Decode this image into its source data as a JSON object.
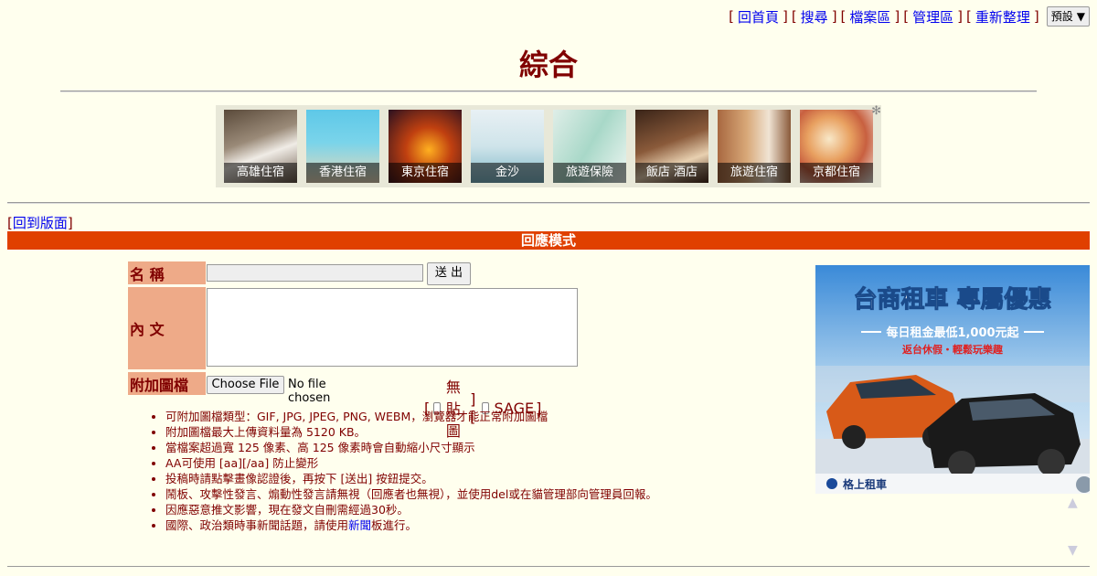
{
  "nav": {
    "links": [
      "回首頁",
      "搜尋",
      "檔案區",
      "管理區",
      "重新整理"
    ],
    "style_select": "預設"
  },
  "board_title": "綜合",
  "banner": {
    "tiles": [
      "高雄住宿",
      "香港住宿",
      "東京住宿",
      "金沙",
      "旅遊保險",
      "飯店 酒店",
      "旅遊住宿",
      "京都住宿"
    ]
  },
  "back_link": "回到版面",
  "mode_label": "回應模式",
  "form": {
    "name_label": "名 稱",
    "content_label": "內 文",
    "attach_label": "附加圖檔",
    "send_button": "送 出",
    "file_button": "Choose File",
    "file_status": "No file chosen",
    "no_image_label": "無貼圖",
    "sage_label": "SAGE"
  },
  "rules": [
    "可附加圖檔類型：GIF, JPG, JPEG, PNG, WEBM，瀏覽器才能正常附加圖檔",
    "附加圖檔最大上傳資料量為 5120 KB。",
    "當檔案超過寬 125 像素、高 125 像素時會自動縮小尺寸顯示",
    "AA可使用 [aa][/aa] 防止變形",
    "投稿時請點擊畫像認證後，再按下 [送出] 按鈕提交。",
    "鬧板、攻擊性發言、煽動性發言請無視（回應者也無視），並使用del或在貓管理部向管理員回報。",
    "因應惡意推文影響，現在發文自刪需經過30秒。"
  ],
  "last_rule": {
    "before": "國際、政治類時事新聞話題，請使用",
    "link": "新聞",
    "after": "板進行。"
  },
  "ad": {
    "headline": "台商租車 專屬優惠",
    "subline": "每日租金最低1,000元起",
    "tagline": "返台休假・輕鬆玩樂趣",
    "brand": "格上租車"
  },
  "colors": {
    "background": "#ffffee",
    "text": "#800000",
    "mode_bar": "#e04000",
    "label_bg": "#eeaa88",
    "link": "#0000ee"
  }
}
